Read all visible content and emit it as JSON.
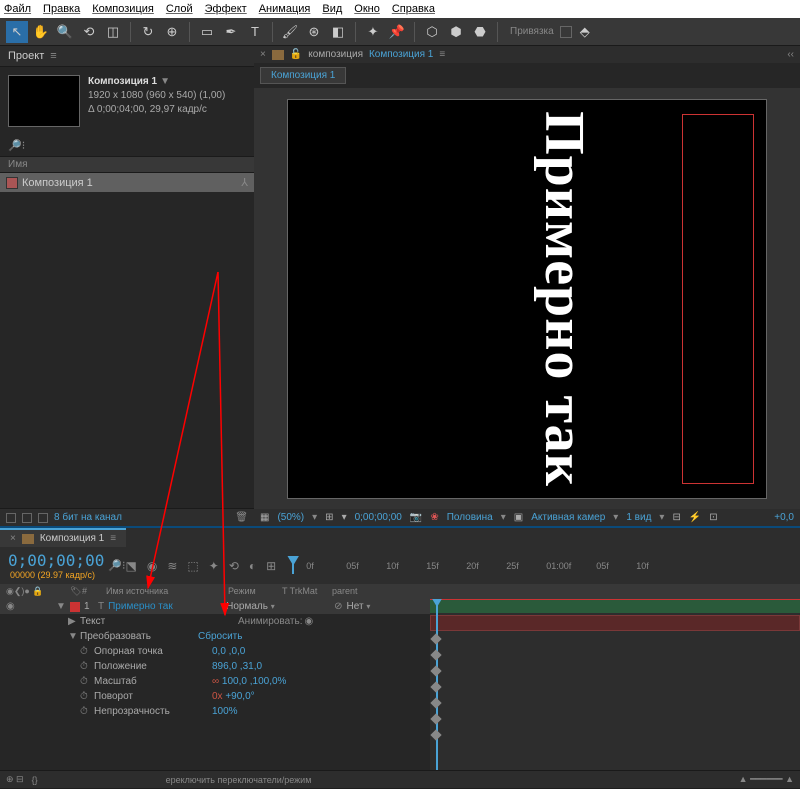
{
  "menu": [
    "Файл",
    "Правка",
    "Композиция",
    "Слой",
    "Эффект",
    "Анимация",
    "Вид",
    "Окно",
    "Справка"
  ],
  "snap_label": "Привязка",
  "project": {
    "tab": "Проект",
    "comp_name": "Композиция 1",
    "dimensions": "1920 x 1080  (960 x 540) (1,00)",
    "duration": "Δ 0;00;04;00, 29,97 кадр/с",
    "col_name": "Имя",
    "item": "Композиция 1",
    "status": "8 бит на канал"
  },
  "viewer": {
    "prefix": "композиция",
    "comp_link": "Композиция 1",
    "subtab": "Композиция 1",
    "canvas_text": "Примерно так",
    "zoom": "(50%)",
    "time": "0;00;00;00",
    "quality": "Половина",
    "camera": "Активная камер",
    "view": "1 вид"
  },
  "timeline": {
    "tab": "Композиция 1",
    "time": "0;00;00;00",
    "subtime": "00000 (29.97 кадр/с)",
    "ruler": [
      "0f",
      "05f",
      "10f",
      "15f",
      "20f",
      "25f",
      "01:00f",
      "05f",
      "10f"
    ],
    "cols": {
      "num": "#",
      "name": "Имя источника",
      "mode": "Режим",
      "trk": "T  TrkMat",
      "parent": "parent"
    },
    "layer": {
      "num": "1",
      "name": "Примерно так",
      "mode": "Нормаль",
      "parent": "Нет"
    },
    "groups": {
      "text": "Текст",
      "animate": "Анимировать:",
      "transform": "Преобразовать",
      "reset": "Сбросить"
    },
    "props": {
      "anchor": {
        "label": "Опорная точка",
        "value": "0,0 ,0,0"
      },
      "position": {
        "label": "Положение",
        "value": "896,0 ,31,0"
      },
      "scale": {
        "label": "Масштаб",
        "value": "100,0 ,100,0%",
        "link": "∞"
      },
      "rotation": {
        "label": "Поворот",
        "value_prefix": "0x",
        "value": "+90,0°"
      },
      "opacity": {
        "label": "Непрозрачность",
        "value": "100%"
      }
    },
    "footer": "ереключить переключатели/режим"
  }
}
